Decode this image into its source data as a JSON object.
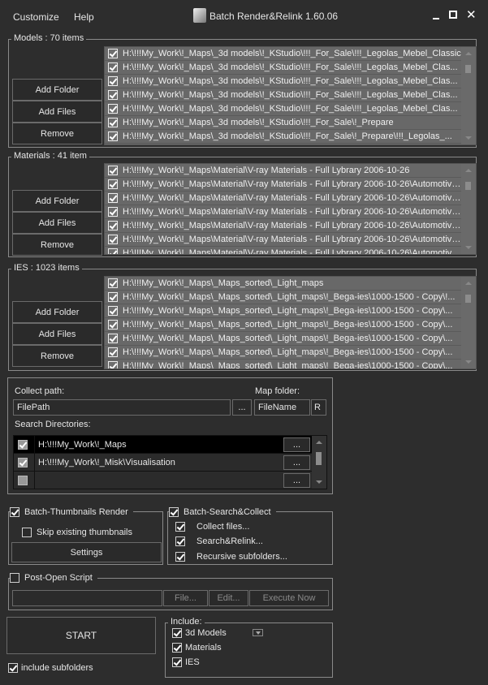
{
  "menu": {
    "customize": "Customize",
    "help": "Help"
  },
  "window": {
    "title": "Batch Render&Relink 1.60.06"
  },
  "models": {
    "label": "Models : 70 items",
    "items": [
      "H:\\!!!My_Work\\!_Maps\\_3d models\\!_KStudio\\!!!_For_Sale\\!!!_Legolas_Mebel_Classic",
      "H:\\!!!My_Work\\!_Maps\\_3d models\\!_KStudio\\!!!_For_Sale\\!!!_Legolas_Mebel_Clas...",
      "H:\\!!!My_Work\\!_Maps\\_3d models\\!_KStudio\\!!!_For_Sale\\!!!_Legolas_Mebel_Clas...",
      "H:\\!!!My_Work\\!_Maps\\_3d models\\!_KStudio\\!!!_For_Sale\\!!!_Legolas_Mebel_Clas...",
      "H:\\!!!My_Work\\!_Maps\\_3d models\\!_KStudio\\!!!_For_Sale\\!!!_Legolas_Mebel_Clas...",
      "H:\\!!!My_Work\\!_Maps\\_3d models\\!_KStudio\\!!!_For_Sale\\!_Prepare",
      "H:\\!!!My_Work\\!_Maps\\_3d models\\!_KStudio\\!!!_For_Sale\\!_Prepare\\!!!_Legolas_..."
    ]
  },
  "materials": {
    "label": "Materials : 41 item",
    "items": [
      "H:\\!!!My_Work\\!_Maps\\Material\\V-ray Materials - Full Lybrary 2006-10-26",
      "H:\\!!!My_Work\\!_Maps\\Material\\V-ray Materials - Full Lybrary 2006-10-26\\Automotive...",
      "H:\\!!!My_Work\\!_Maps\\Material\\V-ray Materials - Full Lybrary 2006-10-26\\Automotive...",
      "H:\\!!!My_Work\\!_Maps\\Material\\V-ray Materials - Full Lybrary 2006-10-26\\Automotive...",
      "H:\\!!!My_Work\\!_Maps\\Material\\V-ray Materials - Full Lybrary 2006-10-26\\Automotive...",
      "H:\\!!!My_Work\\!_Maps\\Material\\V-ray Materials - Full Lybrary 2006-10-26\\Automotive...",
      "H:\\!!!My_Work\\!_Maps\\Material\\V-ray Materials - Full Lybrary 2006-10-26\\Automotive..."
    ]
  },
  "ies": {
    "label": "IES : 1023 items",
    "items": [
      "H:\\!!!My_Work\\!_Maps\\_Maps_sorted\\_Light_maps",
      "H:\\!!!My_Work\\!_Maps\\_Maps_sorted\\_Light_maps\\!_Bega-ies\\1000-1500 - Copy\\!...",
      "H:\\!!!My_Work\\!_Maps\\_Maps_sorted\\_Light_maps\\!_Bega-ies\\1000-1500 - Copy\\...",
      "H:\\!!!My_Work\\!_Maps\\_Maps_sorted\\_Light_maps\\!_Bega-ies\\1000-1500 - Copy\\...",
      "H:\\!!!My_Work\\!_Maps\\_Maps_sorted\\_Light_maps\\!_Bega-ies\\1000-1500 - Copy\\...",
      "H:\\!!!My_Work\\!_Maps\\_Maps_sorted\\_Light_maps\\!_Bega-ies\\1000-1500 - Copy\\...",
      "H:\\!!!My_Work\\!_Maps\\_Maps_sorted\\_Light_maps\\!_Bega-ies\\1000-1500 - Copy\\..."
    ]
  },
  "buttons": {
    "add_folder": "Add Folder",
    "add_files": "Add Files",
    "remove": "Remove"
  },
  "collect": {
    "path_label": "Collect path:",
    "path_value": "FilePath",
    "browse": "...",
    "map_label": "Map folder:",
    "map_value": "FileName",
    "r": "R",
    "search_label": "Search Directories:",
    "dirs": [
      {
        "path": "H:\\!!!My_Work\\!_Maps",
        "checked": true
      },
      {
        "path": "H:\\!!!My_Work\\!_Misk\\Visualisation",
        "checked": true
      },
      {
        "path": "",
        "checked": false
      }
    ]
  },
  "thumbs": {
    "label": "Batch-Thumbnails Render",
    "skip": "Skip existing thumbnails",
    "settings": "Settings"
  },
  "search": {
    "label": "Batch-Search&Collect",
    "collect": "Collect files...",
    "relink": "Search&Relink...",
    "recursive": "Recursive subfolders..."
  },
  "post": {
    "label": "Post-Open Script",
    "value": "",
    "file": "File...",
    "edit": "Edit...",
    "execute": "Execute Now"
  },
  "start": "START",
  "include_subfolders": "include subfolders",
  "include": {
    "label": "Include:",
    "models": "3d Models",
    "materials": "Materials",
    "ies": "IES"
  }
}
